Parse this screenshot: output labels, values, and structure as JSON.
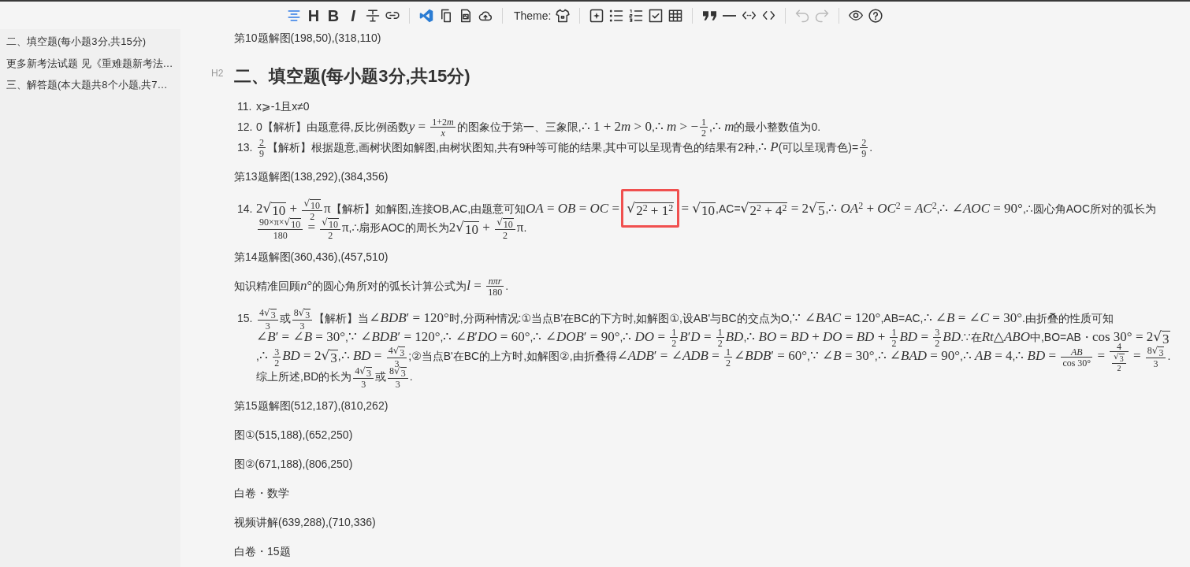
{
  "toolbar": {
    "groups": [
      [
        {
          "kind": "outline",
          "on": true,
          "disabled": false
        },
        {
          "kind": "heading",
          "glyph": "H",
          "on": false,
          "disabled": false
        },
        {
          "kind": "bold",
          "glyph": "B",
          "on": false,
          "disabled": false
        },
        {
          "kind": "italic",
          "glyph": "I",
          "on": false,
          "disabled": false
        },
        {
          "kind": "strike",
          "on": false,
          "disabled": false
        },
        {
          "kind": "link",
          "on": false,
          "disabled": false
        }
      ],
      [
        {
          "kind": "editor",
          "on": false,
          "disabled": false
        },
        {
          "kind": "copy",
          "on": false,
          "disabled": false
        },
        {
          "kind": "export",
          "on": false,
          "disabled": false
        },
        {
          "kind": "upload",
          "on": false,
          "disabled": false
        }
      ],
      [
        {
          "kind": "theme",
          "label": "Theme:",
          "on": false,
          "disabled": false
        }
      ],
      [
        {
          "kind": "insert",
          "on": false,
          "disabled": false
        },
        {
          "kind": "bullets",
          "on": false,
          "disabled": false
        },
        {
          "kind": "numbers",
          "on": false,
          "disabled": false
        },
        {
          "kind": "tasks",
          "on": false,
          "disabled": false
        },
        {
          "kind": "table",
          "on": false,
          "disabled": false
        }
      ],
      [
        {
          "kind": "quote",
          "on": false,
          "disabled": false
        },
        {
          "kind": "rule",
          "on": false,
          "disabled": false
        },
        {
          "kind": "inline_code",
          "on": false,
          "disabled": false
        },
        {
          "kind": "code",
          "on": false,
          "disabled": false
        }
      ],
      [
        {
          "kind": "undo",
          "on": false,
          "disabled": true
        },
        {
          "kind": "redo",
          "on": false,
          "disabled": true
        }
      ],
      [
        {
          "kind": "preview",
          "on": false,
          "disabled": false
        },
        {
          "kind": "help",
          "on": false,
          "disabled": false
        }
      ]
    ]
  },
  "sidebar": {
    "items": [
      "二、填空题(每小题3分,共15分)",
      "更多新考法试题 见《重难题新考法…",
      "三、解答题(本大题共8个小题,共7…"
    ]
  },
  "document": [
    {
      "kind": "paragraph",
      "parts": [
        "第10题解图(198,50),(318,110)"
      ]
    },
    {
      "kind": "heading",
      "marker": "H2",
      "text": "二、填空题(每小题3分,共15分)"
    },
    {
      "kind": "list",
      "items": [
        {
          "number": "11.",
          "parts": [
            "x⩾-1且x≠0"
          ]
        },
        {
          "number": "12.",
          "parts": [
            "0【解析】由题意得,反比例函数",
            {
              "kind": "math",
              "text": "*y* = "
            },
            {
              "kind": "frac",
              "num": [
                {
                  "kind": "math",
                  "text": "1+2"
                },
                {
                  "kind": "math",
                  "text": "*m*"
                }
              ],
              "den": "*x*"
            },
            "的图象位于第一、三象限,",
            {
              "kind": "math",
              "text": "∴ 1 + 2"
            },
            {
              "kind": "math",
              "text": "*m* > 0"
            },
            ",",
            {
              "kind": "math",
              "text": "∴ *m* > −"
            },
            {
              "kind": "frac",
              "num": "1",
              "den": "2"
            },
            ",",
            {
              "kind": "math",
              "text": "∴ *m*"
            },
            "的最小整数值为0."
          ]
        },
        {
          "number": "13.",
          "parts": [
            {
              "kind": "frac",
              "num": "2",
              "den": "9"
            },
            "【解析】根据题意,画树状图如解图,由树状图知,共有9种等可能的结果,其中可以呈现青色的结果有2种,",
            {
              "kind": "math",
              "text": "∴ *P*"
            },
            "(可以呈现青色)=",
            {
              "kind": "frac",
              "num": "2",
              "den": "9"
            },
            "."
          ]
        }
      ]
    },
    {
      "kind": "paragraph",
      "parts": [
        "第13题解图(138,292),(384,356)"
      ]
    },
    {
      "kind": "list",
      "items": [
        {
          "number": "14.",
          "parts": [
            {
              "kind": "math",
              "text": "2"
            },
            {
              "kind": "sqrt",
              "sign": "√",
              "body": "10"
            },
            {
              "kind": "math",
              "text": " + "
            },
            {
              "kind": "frac",
              "num": [
                {
                  "kind": "sqrt",
                  "sign": "√",
                  "body": "10"
                }
              ],
              "den": "2"
            },
            {
              "kind": "math",
              "text": "π"
            },
            "【解析】如解图,连接OB,AC,由题意可知",
            {
              "kind": "math",
              "text": "*OA* = *OB* = *OC* = "
            },
            {
              "kind": "sqrt",
              "sign": "√",
              "body": "2$^{2}$ + 1$^{2}$",
              "highlight": true
            },
            {
              "kind": "math",
              "text": " = "
            },
            {
              "kind": "sqrt",
              "sign": "√",
              "body": "10"
            },
            ",AC=",
            {
              "kind": "sqrt",
              "sign": "√",
              "body": "2$^{2}$ + 4$^{2}$"
            },
            {
              "kind": "math",
              "text": " = 2"
            },
            {
              "kind": "sqrt",
              "sign": "√",
              "body": "5"
            },
            ",",
            {
              "kind": "math",
              "text": "∴ *OA*$^{2}$ + *OC*$^{2}$ = *AC*$^{2}$"
            },
            ",",
            {
              "kind": "math",
              "text": "∴ ∠*AOC* = 90°"
            },
            ",∴圆心角AOC所对的弧长为",
            {
              "kind": "frac",
              "num": [
                {
                  "kind": "math",
                  "text": "90×π×"
                },
                {
                  "kind": "sqrt",
                  "sign": "√",
                  "body": "10"
                }
              ],
              "den": "180"
            },
            {
              "kind": "math",
              "text": " = "
            },
            {
              "kind": "frac",
              "num": [
                {
                  "kind": "sqrt",
                  "sign": "√",
                  "body": "10"
                }
              ],
              "den": "2"
            },
            {
              "kind": "math",
              "text": "π"
            },
            ",∴扇形AOC的周长为",
            {
              "kind": "math",
              "text": "2"
            },
            {
              "kind": "sqrt",
              "sign": "√",
              "body": "10"
            },
            {
              "kind": "math",
              "text": " + "
            },
            {
              "kind": "frac",
              "num": [
                {
                  "kind": "sqrt",
                  "sign": "√",
                  "body": "10"
                }
              ],
              "den": "2"
            },
            {
              "kind": "math",
              "text": "π"
            },
            "."
          ]
        }
      ]
    },
    {
      "kind": "paragraph",
      "parts": [
        "第14题解图(360,436),(457,510)"
      ]
    },
    {
      "kind": "paragraph",
      "parts": [
        "知识精准回顾",
        {
          "kind": "math",
          "text": "*n*°"
        },
        "的圆心角所对的弧长计算公式为",
        {
          "kind": "math",
          "text": "*l* = "
        },
        {
          "kind": "frac",
          "num": "*nπr*",
          "den": "180"
        },
        "."
      ]
    },
    {
      "kind": "list",
      "items": [
        {
          "number": "15.",
          "parts": [
            {
              "kind": "frac",
              "num": [
                {
                  "kind": "math",
                  "text": "4"
                },
                {
                  "kind": "sqrt",
                  "sign": "√",
                  "body": "3"
                }
              ],
              "den": "3"
            },
            "或",
            {
              "kind": "frac",
              "num": [
                {
                  "kind": "math",
                  "text": "8"
                },
                {
                  "kind": "sqrt",
                  "sign": "√",
                  "body": "3"
                }
              ],
              "den": "3"
            },
            "【解析】当",
            {
              "kind": "math",
              "text": "∠*BDB*′ = 120°"
            },
            "时,分两种情况:①当点B'在BC的下方时,如解图①,设AB'与BC的交点为O,",
            {
              "kind": "math",
              "text": "∵ ∠*BAC* = 120°"
            },
            ",AB=AC,",
            {
              "kind": "math",
              "text": "∴ ∠*B* = ∠*C* = 30°"
            },
            ".由折叠的性质可知",
            {
              "kind": "math",
              "text": "∠*B*′ = ∠*B* = 30°"
            },
            ",",
            {
              "kind": "math",
              "text": "∵ ∠*BDB*′ = 120°"
            },
            ",",
            {
              "kind": "math",
              "text": "∴ ∠*B*′*DO* = 60°"
            },
            ",",
            {
              "kind": "math",
              "text": "∴ ∠*DOB*′ = 90°"
            },
            ",",
            {
              "kind": "math",
              "text": "∴ *DO* = "
            },
            {
              "kind": "frac",
              "num": "1",
              "den": "2"
            },
            {
              "kind": "math",
              "text": "*B*′*D* = "
            },
            {
              "kind": "frac",
              "num": "1",
              "den": "2"
            },
            {
              "kind": "math",
              "text": "*BD*"
            },
            ",",
            {
              "kind": "math",
              "text": "∴ *BO* = *BD* + *DO* = *BD* + "
            },
            {
              "kind": "frac",
              "num": "1",
              "den": "2"
            },
            {
              "kind": "math",
              "text": "*BD* = "
            },
            {
              "kind": "frac",
              "num": "3",
              "den": "2"
            },
            {
              "kind": "math",
              "text": "*BD*"
            },
            ".∵在",
            {
              "kind": "math",
              "text": "*Rt*△*ABO*"
            },
            "中,BO=AB・",
            {
              "kind": "math",
              "text": "cos 30° = 2"
            },
            {
              "kind": "sqrt",
              "sign": "√",
              "body": "3"
            },
            ",",
            {
              "kind": "math",
              "text": "∴ "
            },
            {
              "kind": "frac",
              "num": "3",
              "den": "2"
            },
            {
              "kind": "math",
              "text": "*BD* = 2"
            },
            {
              "kind": "sqrt",
              "sign": "√",
              "body": "3"
            },
            ",",
            {
              "kind": "math",
              "text": "∴ *BD* = "
            },
            {
              "kind": "frac",
              "num": [
                {
                  "kind": "math",
                  "text": "4"
                },
                {
                  "kind": "sqrt",
                  "sign": "√",
                  "body": "3"
                }
              ],
              "den": "3"
            },
            ";②当点B'在BC的上方时,如解图②,由折叠得",
            {
              "kind": "math",
              "text": "∠*ADB*′ = ∠*ADB* = "
            },
            {
              "kind": "frac",
              "num": "1",
              "den": "2"
            },
            {
              "kind": "math",
              "text": "∠*BDB*′ = 60°"
            },
            ",",
            {
              "kind": "math",
              "text": "∵ ∠*B* = 30°"
            },
            ",",
            {
              "kind": "math",
              "text": "∴ ∠*BAD* = 90°"
            },
            ",",
            {
              "kind": "math",
              "text": "∴ *AB* = 4"
            },
            ",",
            {
              "kind": "math",
              "text": "∴ *BD* = "
            },
            {
              "kind": "frac",
              "num": "*AB*",
              "den": "cos 30°"
            },
            {
              "kind": "math",
              "text": " = "
            },
            {
              "kind": "frac",
              "num": "4",
              "den": [
                {
                  "kind": "frac",
                  "num": [
                    {
                      "kind": "sqrt",
                      "sign": "√",
                      "body": "3"
                    }
                  ],
                  "den": "2"
                }
              ]
            },
            {
              "kind": "math",
              "text": " = "
            },
            {
              "kind": "frac",
              "num": [
                {
                  "kind": "math",
                  "text": "8"
                },
                {
                  "kind": "sqrt",
                  "sign": "√",
                  "body": "3"
                }
              ],
              "den": "3"
            },
            ".综上所述,BD的长为",
            {
              "kind": "frac",
              "num": [
                {
                  "kind": "math",
                  "text": "4"
                },
                {
                  "kind": "sqrt",
                  "sign": "√",
                  "body": "3"
                }
              ],
              "den": "3"
            },
            "或",
            {
              "kind": "frac",
              "num": [
                {
                  "kind": "math",
                  "text": "8"
                },
                {
                  "kind": "sqrt",
                  "sign": "√",
                  "body": "3"
                }
              ],
              "den": "3"
            },
            "."
          ]
        }
      ]
    },
    {
      "kind": "paragraph",
      "parts": [
        "第15题解图(512,187),(810,262)"
      ]
    },
    {
      "kind": "paragraph",
      "parts": [
        "图①(515,188),(652,250)"
      ]
    },
    {
      "kind": "paragraph",
      "parts": [
        "图②(671,188),(806,250)"
      ]
    },
    {
      "kind": "paragraph",
      "parts": [
        "白卷・数学"
      ]
    },
    {
      "kind": "paragraph",
      "parts": [
        "视频讲解(639,288),(710,336)"
      ]
    },
    {
      "kind": "paragraph",
      "parts": [
        "白卷・15题"
      ]
    }
  ]
}
